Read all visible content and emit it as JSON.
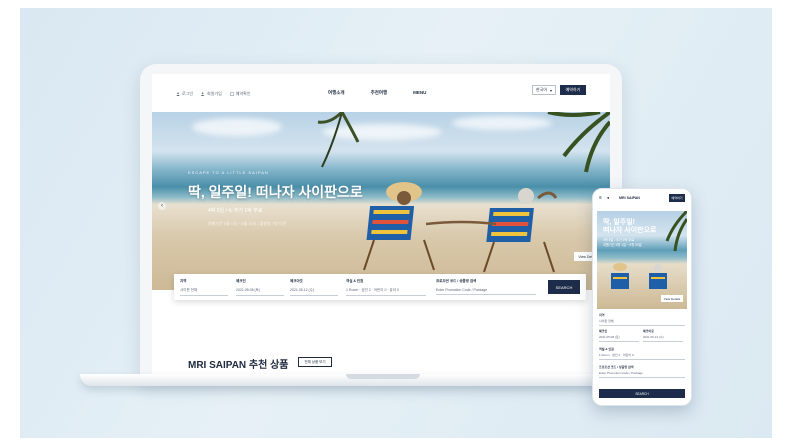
{
  "colors": {
    "navy": "#1c2c4a",
    "background": "#e2eef5",
    "sea": "#4a8fa9",
    "sand": "#d9c9ac"
  },
  "laptop": {
    "header": {
      "util": [
        "로그인",
        "회원가입",
        "예약확인"
      ],
      "nav": [
        "여행소개",
        "추천여행",
        "MENU"
      ],
      "lang_select": "한국어",
      "book_button": "예약하기"
    },
    "hero": {
      "subtitle": "ESCAPE TO A LITTLE SAIPAN",
      "title": "딱, 일주일! 떠나자 사이판으로",
      "line1": "4박 5일 / 4, 추가 1박 무료",
      "line2": "여행기간 5월 1일 ~ 6월 30일 / 출발일 7일 이전",
      "view_details": "View Details",
      "prev_icon": "chevron-left-icon",
      "next_icon": "chevron-right-icon"
    },
    "search": {
      "fields": [
        {
          "label": "지역",
          "value": "사이판 전체"
        },
        {
          "label": "체크인",
          "value": "2021.05.08 (토)"
        },
        {
          "label": "체크아웃",
          "value": "2021.05.12 (수)"
        },
        {
          "label": "객실 & 인원",
          "value": "1 Room · 성인 2 · 어린이 0 · 유아 0"
        },
        {
          "label": "프로모션 코드 / 상품명 검색",
          "value": "Enter Promotion Code / Package"
        }
      ],
      "button": "SEARCH"
    },
    "section": {
      "title": "MRI SAIPAN 추천 상품",
      "button": "전체 상품 보기"
    }
  },
  "phone": {
    "logo": "MRI SAIPAN",
    "book_button": "예약하기",
    "hero": {
      "title_line1": "딱, 일주일!",
      "title_line2": "떠나자 사이판으로",
      "sub1": "4박 5일 / 추가 1박 무료",
      "sub2": "여행기간 5월 1일 ~ 6월 30일",
      "view_details": "View Details"
    },
    "form": {
      "region_label": "지역",
      "region_value": "사이판 전체",
      "checkin_label": "체크인",
      "checkin_value": "2021.05.08 (토)",
      "checkout_label": "체크아웃",
      "checkout_value": "2021.05.12 (수)",
      "room_label": "객실 & 인원",
      "room_value": "1 Room · 성인 2 · 어린이 0",
      "promo_label": "프로모션 코드 / 상품명 검색",
      "promo_value": "Enter Promotion Code / Package"
    },
    "search_button": "SEARCH"
  }
}
